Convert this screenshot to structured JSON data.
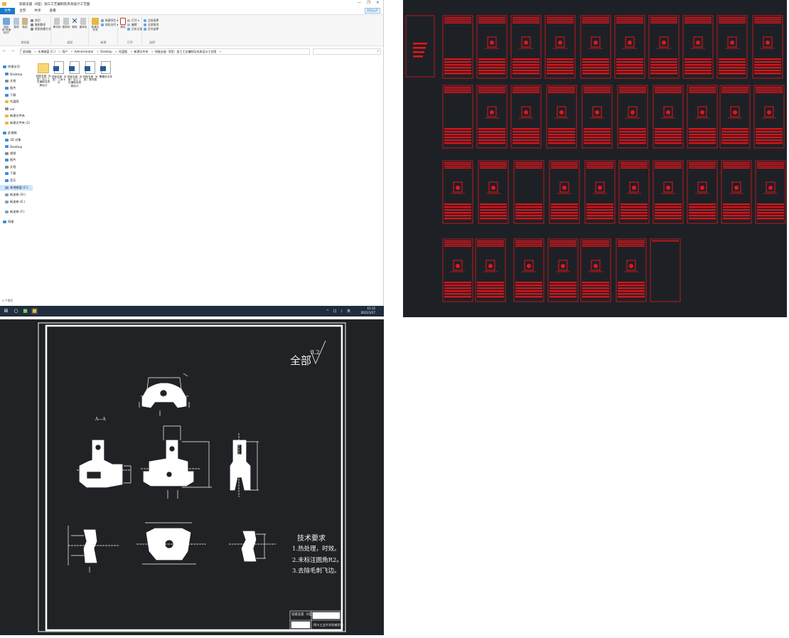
{
  "explorer": {
    "title": "铰链支座（8型）加工工艺编制及夹具设计工艺图",
    "window_buttons": [
      "—",
      "❐",
      "✕"
    ],
    "tabs": [
      "文件",
      "主页",
      "共享",
      "查看"
    ],
    "share_help": "同用云声",
    "ribbon": {
      "clipboard": {
        "label": "剪贴板",
        "pin": "固定到\"快速访问\"",
        "copy": "复制",
        "paste": "粘贴",
        "cut": "剪切",
        "copy_path": "复制路径",
        "paste_shortcut": "粘贴快捷方式"
      },
      "organize": {
        "label": "组织",
        "move_to": "移动到",
        "copy_to": "复制到",
        "delete": "删除",
        "rename": "重命名"
      },
      "new": {
        "label": "新建",
        "new_folder": "新建文件夹",
        "new_item": "新建项目 ▾",
        "easy_access": "轻松访问 ▾"
      },
      "open": {
        "label": "打开",
        "properties": "属性",
        "open": "打开 ▾",
        "edit": "编辑",
        "history": "历史记录"
      },
      "select": {
        "label": "选择",
        "select_all": "全部选择",
        "select_none": "全部取消",
        "invert": "反向选择"
      }
    },
    "nav_arrows": "← → ↑",
    "breadcrumbs": [
      "此电脑",
      "本地磁盘 (C:)",
      "用户",
      "Administrator",
      "Desktop",
      "托盘图",
      "新建文件夹",
      "铰链支座（8型）加工工艺编制及夹具设计工艺图"
    ],
    "breadcrumb_sep": ">",
    "nav_pane": [
      {
        "label": "快速访问",
        "icon": "star-icon",
        "color": "#3c8dde"
      },
      {
        "label": "Desktop",
        "icon": "desktop-icon",
        "color": "#3c8dde"
      },
      {
        "label": "文档",
        "icon": "document-icon",
        "color": "#8a8a8a"
      },
      {
        "label": "图片",
        "icon": "picture-icon",
        "color": "#3c8dde"
      },
      {
        "label": "下载",
        "icon": "download-icon",
        "color": "#3c8dde"
      },
      {
        "label": "托盘图",
        "icon": "folder-icon",
        "color": "#e8b93c"
      },
      {
        "label": "ver",
        "icon": "search-icon",
        "color": "#8a8a8a"
      },
      {
        "label": "新建文件夹",
        "icon": "folder-icon",
        "color": "#e8b93c"
      },
      {
        "label": "新建文件夹 (2)",
        "icon": "folder-icon",
        "color": "#e8b93c"
      },
      {
        "label": "此电脑",
        "icon": "computer-icon",
        "color": "#3c8dde"
      },
      {
        "label": "3D 对象",
        "icon": "cube-icon",
        "color": "#3c8dde"
      },
      {
        "label": "Desktop",
        "icon": "desktop-icon",
        "color": "#3c8dde"
      },
      {
        "label": "视频",
        "icon": "video-icon",
        "color": "#8a8a8a"
      },
      {
        "label": "图片",
        "icon": "picture-icon",
        "color": "#3c8dde"
      },
      {
        "label": "文档",
        "icon": "document-icon",
        "color": "#8a8a8a"
      },
      {
        "label": "下载",
        "icon": "download-icon",
        "color": "#3c8dde"
      },
      {
        "label": "音乐",
        "icon": "music-icon",
        "color": "#3c8dde"
      },
      {
        "label": "本地磁盘 (C:)",
        "icon": "drive-icon",
        "color": "#7fa0c0"
      },
      {
        "label": "新加卷 (D:)",
        "icon": "drive-icon",
        "color": "#7fa0c0"
      },
      {
        "label": "新加卷 (E:)",
        "icon": "drive-icon",
        "color": "#7fa0c0"
      },
      {
        "label": "新加卷 (F:)",
        "icon": "drive-icon",
        "color": "#7fa0c0"
      },
      {
        "label": "网络",
        "icon": "network-icon",
        "color": "#3c8dde"
      }
    ],
    "files": [
      {
        "name": "铰链支座（8型）加工工艺编制及夹具设计",
        "type": "folder"
      },
      {
        "name": "铰链支座（8型）工序卡片",
        "type": "word"
      },
      {
        "name": "铰链支座（8型）加工工艺编制及夹具设计",
        "type": "word"
      },
      {
        "name": "铰链支座（8型）零件图",
        "type": "word"
      },
      {
        "name": "需要的文件",
        "type": "word"
      }
    ],
    "status": "5 个项目"
  },
  "taskbar": {
    "time": "15:12",
    "date": "2021/1/27",
    "tray_symbols": "^ 口 ♪ 英"
  },
  "drawing": {
    "roughness_label": "全部",
    "roughness_value": "3.2",
    "section_label": "A—A",
    "tech_title": "技术要求",
    "tech_items": [
      "1.热处理，时效。",
      "2.未标注圆角R2。",
      "3.去除毛刺飞边。"
    ],
    "title_block_name": "铰链支座（8型）",
    "title_block_school": "四川工业大学机械学院"
  },
  "colors": {
    "accent": "#1979ca",
    "cad_red": "#e8141b",
    "cad_bg": "#1d2126"
  }
}
